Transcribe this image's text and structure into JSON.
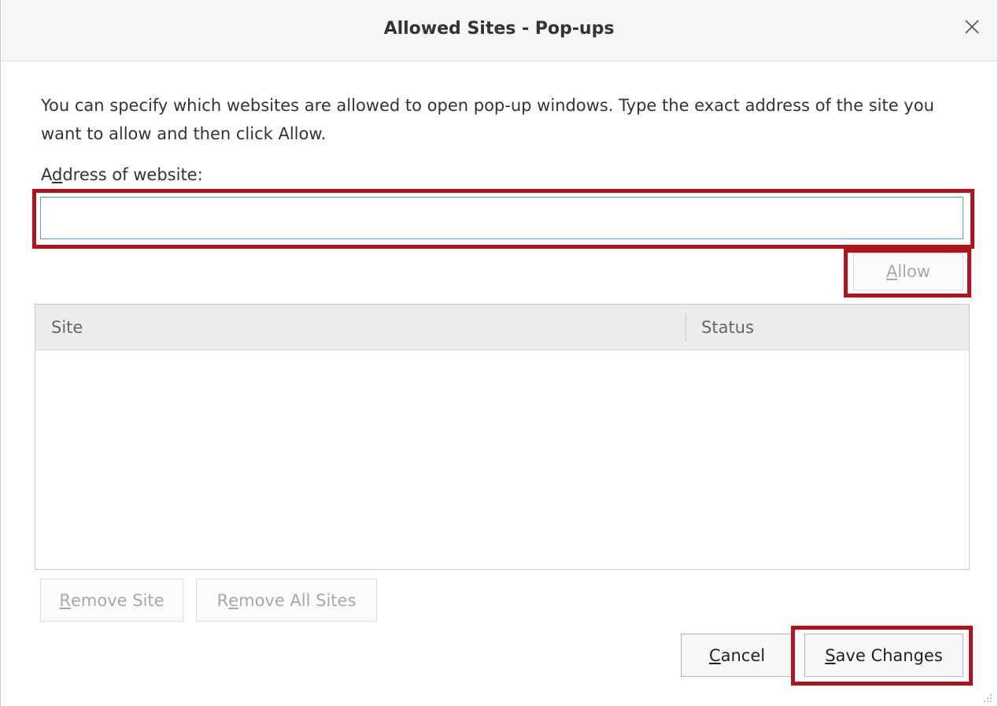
{
  "dialog": {
    "title": "Allowed Sites - Pop-ups",
    "close_icon": "close-icon"
  },
  "description": "You can specify which websites are allowed to open pop-up windows. Type the exact address of the site you want to allow and then click Allow.",
  "address": {
    "label_pre": "A",
    "label_access": "d",
    "label_post": "dress of website:",
    "value": "",
    "placeholder": ""
  },
  "allow_button": {
    "access": "A",
    "rest": "llow",
    "disabled": true
  },
  "table": {
    "columns": [
      "Site",
      "Status"
    ],
    "rows": []
  },
  "remove_site_button": {
    "access": "R",
    "rest": "emove Site",
    "disabled": true
  },
  "remove_all_button": {
    "pre": "R",
    "access": "e",
    "rest": "move All Sites",
    "disabled": true
  },
  "cancel_button": {
    "access": "C",
    "rest": "ancel"
  },
  "save_button": {
    "access": "S",
    "rest": "ave Changes"
  },
  "colors": {
    "highlight": "#b3121d",
    "input_focus": "#4aa3df",
    "header_bg": "#ececec",
    "titlebar_bg": "#f6f6f6"
  }
}
